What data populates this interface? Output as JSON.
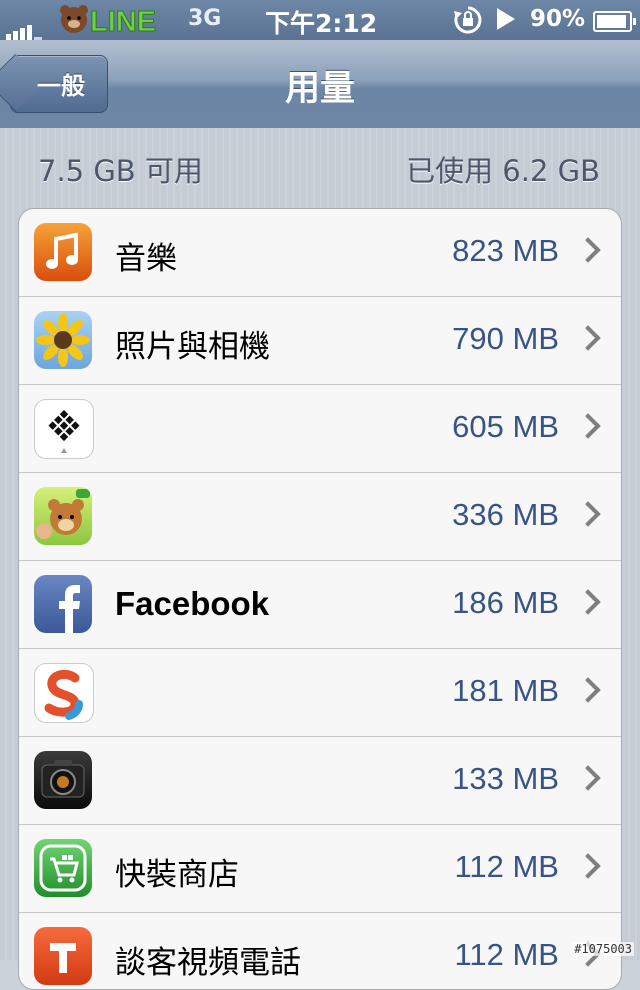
{
  "status_bar": {
    "app_logo_text": "LINE",
    "carrier": "3G",
    "time": "下午2:12",
    "battery_percent": "90%"
  },
  "nav": {
    "back_label": "一般",
    "title": "用量"
  },
  "summary": {
    "available": "7.5 GB 可用",
    "used": "已使用 6.2 GB"
  },
  "apps": [
    {
      "name": "音樂",
      "size": "823 MB",
      "icon": "music-icon"
    },
    {
      "name": "照片與相機",
      "size": "790 MB",
      "icon": "photos-sunflower-icon"
    },
    {
      "name": "",
      "size": "605 MB",
      "icon": "diamond-pattern-app-icon"
    },
    {
      "name": "",
      "size": "336 MB",
      "icon": "line-bear-game-icon"
    },
    {
      "name": "Facebook",
      "size": "186 MB",
      "icon": "facebook-icon"
    },
    {
      "name": "",
      "size": "181 MB",
      "icon": "s-app-icon"
    },
    {
      "name": "",
      "size": "133 MB",
      "icon": "camera-app-icon"
    },
    {
      "name": "快裝商店",
      "size": "112 MB",
      "icon": "shopping-cart-icon"
    },
    {
      "name": "談客視頻電話",
      "size": "112 MB",
      "icon": "tango-icon"
    }
  ],
  "watermark": "#1075003"
}
